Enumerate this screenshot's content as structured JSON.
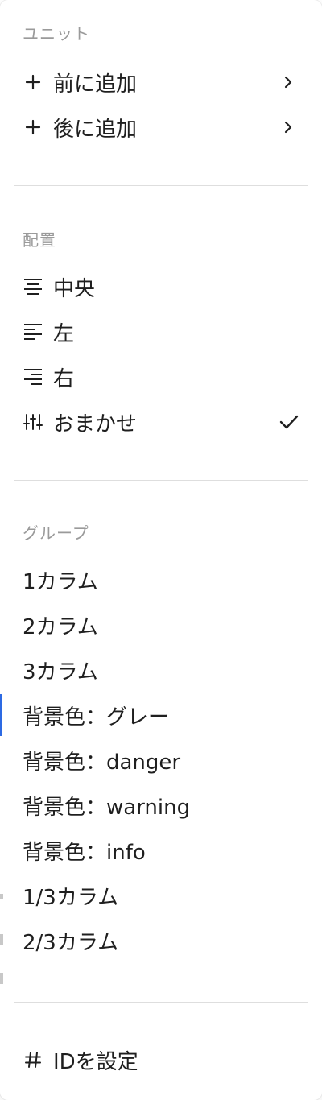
{
  "unit": {
    "title": "ユニット",
    "items": [
      {
        "label": "前に追加"
      },
      {
        "label": "後に追加"
      }
    ]
  },
  "align": {
    "title": "配置",
    "items": [
      {
        "label": "中央"
      },
      {
        "label": "左"
      },
      {
        "label": "右"
      },
      {
        "label": "おまかせ",
        "selected": true
      }
    ]
  },
  "group": {
    "title": "グループ",
    "items": [
      {
        "label": "1カラム"
      },
      {
        "label": "2カラム"
      },
      {
        "label": "3カラム"
      },
      {
        "label": "背景色：グレー"
      },
      {
        "label": "背景色：danger"
      },
      {
        "label": "背景色：warning"
      },
      {
        "label": "背景色：info"
      },
      {
        "label": "1/3カラム"
      },
      {
        "label": "2/3カラム"
      }
    ]
  },
  "footer": {
    "items": [
      {
        "label": "IDを設定"
      }
    ]
  },
  "colors": {
    "text": "#1f1f1f",
    "section_title": "#9a9a9a",
    "divider": "#dedede",
    "accent": "#2d6ae3"
  }
}
